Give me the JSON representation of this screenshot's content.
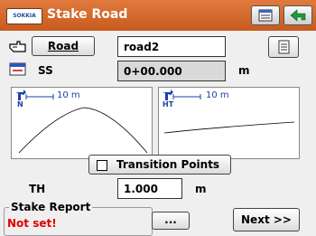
{
  "app": {
    "logo_text": "SOKKIA",
    "title": "Stake Road"
  },
  "road": {
    "button_label": "Road",
    "value": "road2"
  },
  "ss": {
    "label": "SS",
    "value": "0+00.000",
    "unit": "m"
  },
  "profile_left": {
    "corner_label": "N",
    "scale_label": "10 m"
  },
  "profile_right": {
    "corner_label": "HT",
    "scale_label": "10 m"
  },
  "transition": {
    "label": "Transition Points",
    "checked": false
  },
  "th": {
    "label": "TH",
    "value": "1.000",
    "unit": "m"
  },
  "stake_report": {
    "legend": "Stake Report",
    "status": "Not set!",
    "browse_label": "..."
  },
  "next_button": {
    "label": "Next >>"
  },
  "colors": {
    "titlebar": "#d8692c",
    "status_red": "#e00000",
    "accent_blue": "#1e3fa8"
  }
}
